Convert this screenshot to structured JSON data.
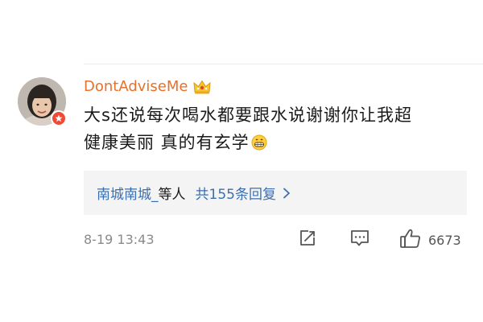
{
  "comment": {
    "username": "DontAdviseMe",
    "text_line1": "大s还说每次喝水都要跟水说谢谢你让我超",
    "text_line2": "健康美丽 真的有玄学",
    "emoji": "grin-icon"
  },
  "replies": {
    "names": "南城南城_",
    "separator": "等人",
    "count_label": "共155条回复"
  },
  "meta": {
    "timestamp": "8-19 13:43",
    "likes": "6673"
  },
  "icons": {
    "badge": "crown-icon",
    "verified": "verified-badge-icon",
    "share": "share-icon",
    "comment": "comment-icon",
    "like": "thumbs-up-icon"
  },
  "colors": {
    "username": "#e8702a",
    "link": "#3b6fb0",
    "badge_red": "#f04a37",
    "reply_bg": "#f4f4f4"
  }
}
